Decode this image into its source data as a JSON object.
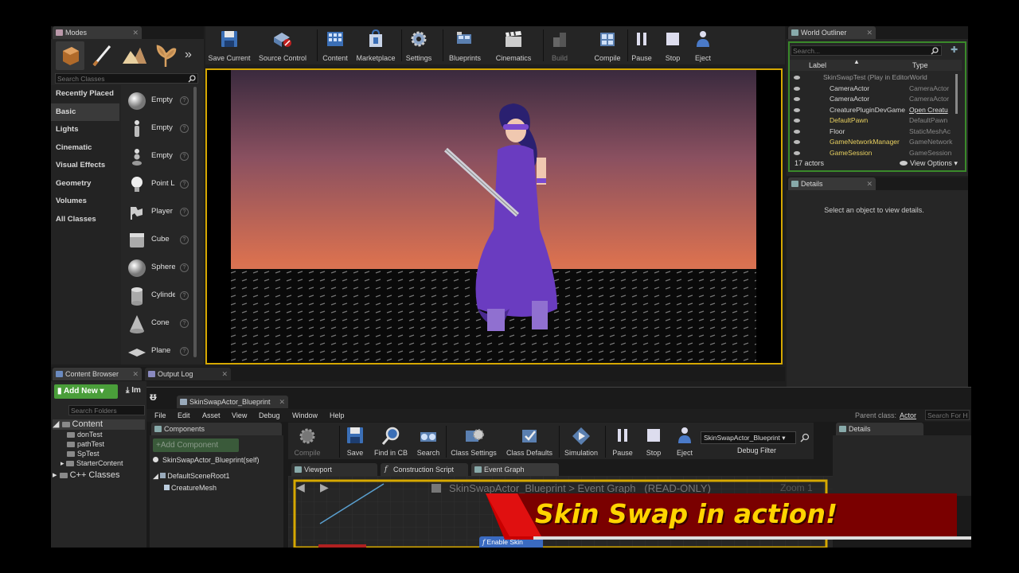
{
  "modes": {
    "tab": "Modes",
    "search_placeholder": "Search Classes",
    "categories": [
      "Recently Placed",
      "Basic",
      "Lights",
      "Cinematic",
      "Visual Effects",
      "Geometry",
      "Volumes",
      "All Classes"
    ],
    "items": [
      "Empty",
      "Empty",
      "Empty",
      "Point L",
      "Player",
      "Cube",
      "Sphere",
      "Cylinde",
      "Cone",
      "Plane"
    ]
  },
  "toolbar": {
    "save_current": "Save Current",
    "source_control": "Source Control",
    "content": "Content",
    "marketplace": "Marketplace",
    "settings": "Settings",
    "blueprints": "Blueprints",
    "cinematics": "Cinematics",
    "build": "Build",
    "compile": "Compile",
    "pause": "Pause",
    "stop": "Stop",
    "eject": "Eject"
  },
  "outliner": {
    "tab": "World Outliner",
    "search_placeholder": "Search...",
    "col_label": "Label",
    "col_type": "Type",
    "rows": [
      {
        "label": "SkinSwapTest (Play in EditorWorld",
        "type": ""
      },
      {
        "label": "CameraActor",
        "type": "CameraActor"
      },
      {
        "label": "CameraActor",
        "type": "CameraActor"
      },
      {
        "label": "CreaturePluginDevGame",
        "type": "Open Creatu"
      },
      {
        "label": "DefaultPawn",
        "type": "DefaultPawn"
      },
      {
        "label": "Floor",
        "type": "StaticMeshAc"
      },
      {
        "label": "GameNetworkManager",
        "type": "GameNetwork"
      },
      {
        "label": "GameSession",
        "type": "GameSession"
      }
    ],
    "count": "17 actors",
    "view_options": "View Options"
  },
  "details": {
    "tab": "Details",
    "empty": "Select an object to view details."
  },
  "content_browser": {
    "tab": "Content Browser",
    "output_tab": "Output Log",
    "add_new": "Add New",
    "import_short": "Im",
    "search_folders": "Search Folders",
    "tree": [
      "Content",
      "donTest",
      "pathTest",
      "SpTest",
      "StarterContent",
      "C++ Classes"
    ]
  },
  "bp": {
    "tab": "SkinSwapActor_Blueprint",
    "menu": [
      "File",
      "Edit",
      "Asset",
      "View",
      "Debug",
      "Window",
      "Help"
    ],
    "parent_class_label": "Parent class:",
    "parent_class_value": "Actor",
    "search_for": "Search For H",
    "components_tab": "Components",
    "add_component": "+Add Component",
    "self_item": "SkinSwapActor_Blueprint(self)",
    "scene_root": "DefaultSceneRoot1",
    "mesh": "CreatureMesh",
    "toolbar": {
      "compile": "Compile",
      "save": "Save",
      "find_in_cb": "Find in CB",
      "search": "Search",
      "class_settings": "Class Settings",
      "class_defaults": "Class Defaults",
      "simulation": "Simulation",
      "pause": "Pause",
      "stop": "Stop",
      "eject": "Eject",
      "debug_select": "SkinSwapActor_Blueprint",
      "debug_filter": "Debug Filter"
    },
    "details_tab": "Details",
    "graph_tabs": [
      "Viewport",
      "Construction Script",
      "Event Graph"
    ],
    "breadcrumb": "SkinSwapActor_Blueprint",
    "breadcrumb_graph": "Event Graph",
    "readonly": "(READ-ONLY)",
    "zoom": "Zoom 1",
    "node_label": "Enable Skin"
  },
  "banner": {
    "text": "Skin Swap in action!",
    "color": "#ffd400"
  },
  "colors": {
    "accent_green": "#4a9e3a",
    "viewport_border": "#d6a800",
    "character_purple": "#6a3cc0"
  }
}
